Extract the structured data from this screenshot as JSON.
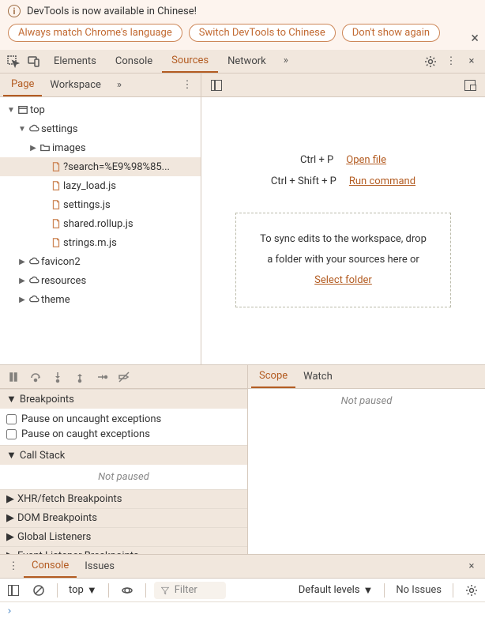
{
  "infobar": {
    "message": "DevTools is now available in Chinese!",
    "buttons": [
      "Always match Chrome's language",
      "Switch DevTools to Chinese",
      "Don't show again"
    ]
  },
  "main_tabs": [
    "Elements",
    "Console",
    "Sources",
    "Network"
  ],
  "main_active": "Sources",
  "nav_tabs": [
    "Page",
    "Workspace"
  ],
  "nav_active": "Page",
  "tree": [
    {
      "depth": 0,
      "arrow": "down",
      "icon": "frame",
      "label": "top"
    },
    {
      "depth": 1,
      "arrow": "down",
      "icon": "cloud",
      "label": "settings"
    },
    {
      "depth": 2,
      "arrow": "right",
      "icon": "folder",
      "label": "images"
    },
    {
      "depth": 3,
      "arrow": "",
      "icon": "file",
      "label": "?search=%E9%98%85...",
      "selected": true
    },
    {
      "depth": 3,
      "arrow": "",
      "icon": "file",
      "label": "lazy_load.js"
    },
    {
      "depth": 3,
      "arrow": "",
      "icon": "file",
      "label": "settings.js"
    },
    {
      "depth": 3,
      "arrow": "",
      "icon": "file",
      "label": "shared.rollup.js"
    },
    {
      "depth": 3,
      "arrow": "",
      "icon": "file",
      "label": "strings.m.js"
    },
    {
      "depth": 1,
      "arrow": "right",
      "icon": "cloud",
      "label": "favicon2"
    },
    {
      "depth": 1,
      "arrow": "right",
      "icon": "cloud",
      "label": "resources"
    },
    {
      "depth": 1,
      "arrow": "right",
      "icon": "cloud",
      "label": "theme"
    }
  ],
  "editor": {
    "shortcut1_key": "Ctrl + P",
    "shortcut1_action": "Open file",
    "shortcut2_key": "Ctrl + Shift + P",
    "shortcut2_action": "Run command",
    "drop_line1": "To sync edits to the workspace, drop",
    "drop_line2": "a folder with your sources here or",
    "drop_link": "Select folder"
  },
  "debugger": {
    "sections": {
      "breakpoints": "Breakpoints",
      "pause_uncaught": "Pause on uncaught exceptions",
      "pause_caught": "Pause on caught exceptions",
      "callstack": "Call Stack",
      "not_paused": "Not paused",
      "xhr": "XHR/fetch Breakpoints",
      "dom": "DOM Breakpoints",
      "global": "Global Listeners",
      "event": "Event Listener Breakpoints"
    },
    "right_tabs": [
      "Scope",
      "Watch"
    ],
    "right_active": "Scope",
    "right_body": "Not paused"
  },
  "drawer": {
    "tabs": [
      "Console",
      "Issues"
    ],
    "active": "Console",
    "context": "top",
    "filter_placeholder": "Filter",
    "levels": "Default levels",
    "issues": "No Issues"
  }
}
